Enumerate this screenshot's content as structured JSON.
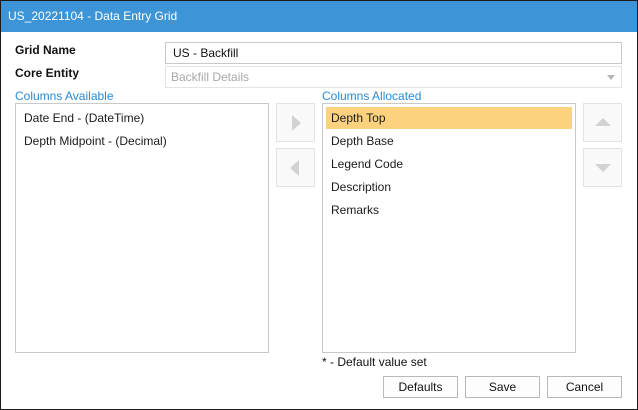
{
  "window": {
    "title": "US_20221104 - Data Entry Grid"
  },
  "form": {
    "grid_name_label": "Grid Name",
    "grid_name_value": "US - Backfill",
    "core_entity_label": "Core Entity",
    "core_entity_value": "Backfill Details"
  },
  "available": {
    "label": "Columns Available",
    "items": [
      "Date End - (DateTime)",
      "Depth Midpoint - (Decimal)"
    ]
  },
  "allocated": {
    "label": "Columns Allocated",
    "selected_index": 0,
    "items": [
      "Depth Top",
      "Depth Base",
      "Legend Code",
      "Description",
      "Remarks"
    ]
  },
  "note": "* - Default value set",
  "buttons": {
    "defaults": "Defaults",
    "save": "Save",
    "cancel": "Cancel"
  },
  "colors": {
    "titlebar": "#3d95d8",
    "accent_label": "#2a8ad2",
    "selection": "#fcd27f"
  },
  "icons": {
    "move_right": "arrow-right-icon",
    "move_left": "arrow-left-icon",
    "move_up": "arrow-up-icon",
    "move_down": "arrow-down-icon",
    "dropdown": "chevron-down-icon"
  }
}
